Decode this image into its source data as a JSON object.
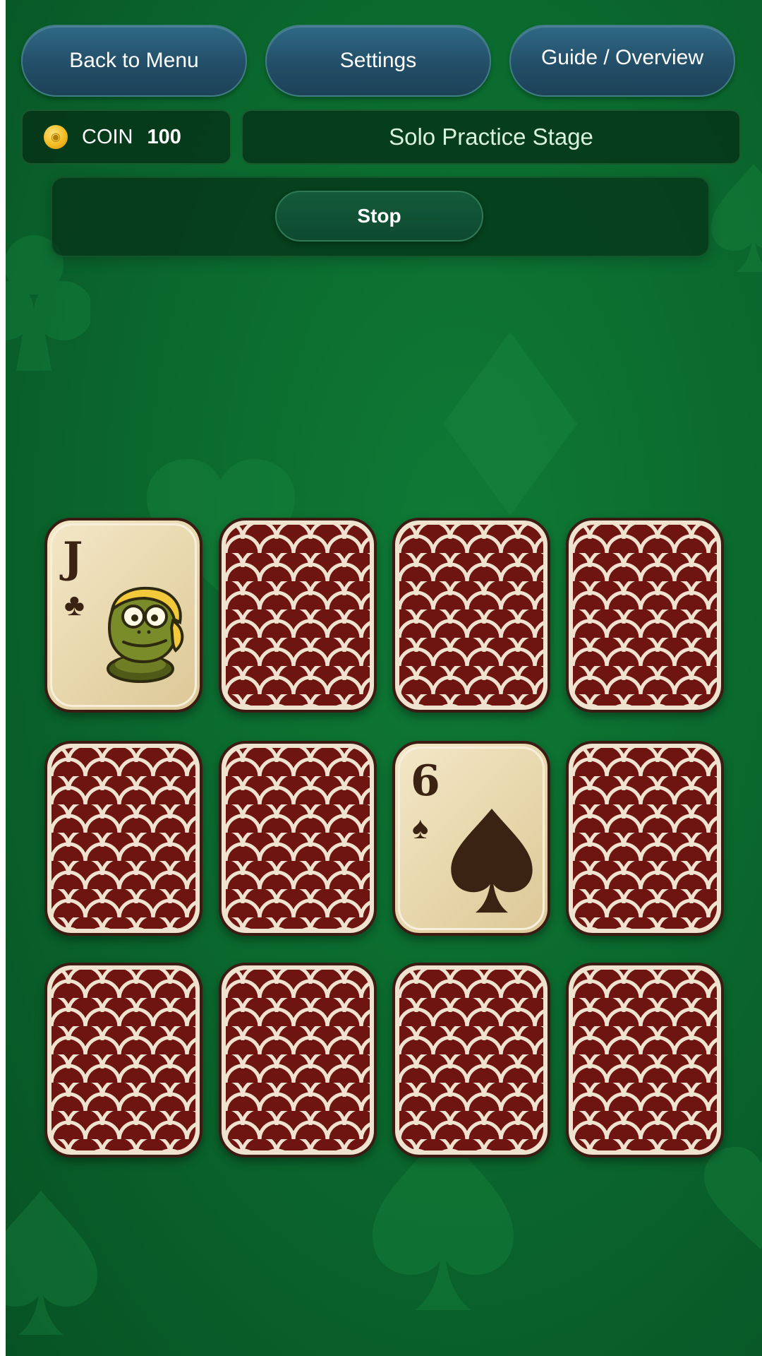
{
  "header": {
    "back_label": "Back to Menu",
    "settings_label": "Settings",
    "guide_label": "Guide / Overview"
  },
  "status": {
    "coin_label": "COIN",
    "coin_value": "100",
    "stage_title": "Solo Practice Stage"
  },
  "controls": {
    "stop_label": "Stop"
  },
  "colors": {
    "table_green": "#0b6a2e",
    "card_back_red": "#6e1512",
    "card_back_cream": "#efe3cf",
    "card_face": "#e6d5a9",
    "button_blue": "#234e68"
  },
  "board": {
    "rows": 3,
    "cols": 4,
    "cards": [
      {
        "state": "face-up",
        "rank": "J",
        "suit": "♣",
        "art": "frog-character-icon"
      },
      {
        "state": "face-down"
      },
      {
        "state": "face-down"
      },
      {
        "state": "face-down"
      },
      {
        "state": "face-down"
      },
      {
        "state": "face-down"
      },
      {
        "state": "face-up",
        "rank": "6",
        "suit": "♠",
        "art": "spade-pip-icon"
      },
      {
        "state": "face-down"
      },
      {
        "state": "face-down"
      },
      {
        "state": "face-down"
      },
      {
        "state": "face-down"
      },
      {
        "state": "face-down"
      }
    ]
  }
}
